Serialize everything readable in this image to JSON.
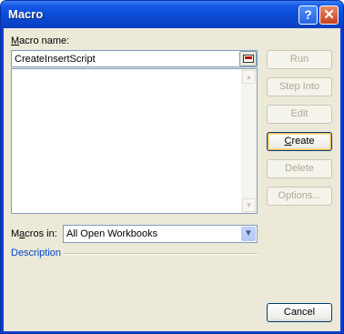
{
  "window": {
    "title": "Macro"
  },
  "titlebar": {
    "help_glyph": "?",
    "close_glyph": "✕"
  },
  "macro_name": {
    "label_underlined": "M",
    "label_rest": "acro name:",
    "value": "CreateInsertScript"
  },
  "macro_list": {
    "items": []
  },
  "buttons": {
    "run": "Run",
    "step_into": "Step Into",
    "edit": "Edit",
    "create_underlined": "C",
    "create_rest": "reate",
    "delete": "Delete",
    "options": "Options...",
    "cancel": "Cancel"
  },
  "macros_in": {
    "label_pre": "M",
    "label_underlined": "a",
    "label_rest": "cros in:",
    "value": "All Open Workbooks"
  },
  "description": {
    "label": "Description"
  },
  "icons": {
    "collapse": "collapse-dialog-icon",
    "scroll_up": "▲",
    "scroll_down": "▼",
    "dropdown": "▼"
  }
}
